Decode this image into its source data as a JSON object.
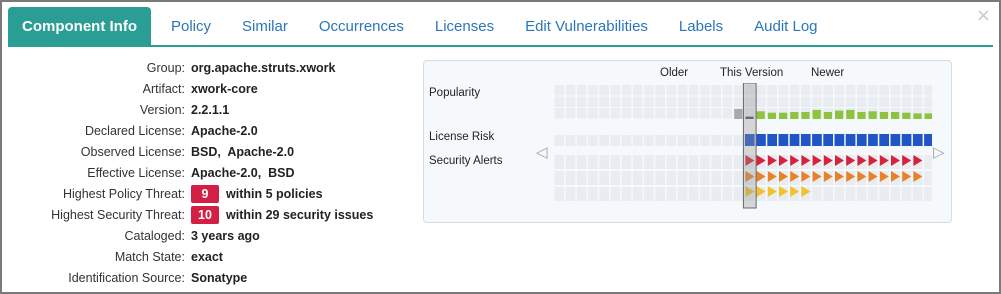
{
  "tabs": [
    {
      "label": "Component Info",
      "active": true
    },
    {
      "label": "Policy"
    },
    {
      "label": "Similar"
    },
    {
      "label": "Occurrences"
    },
    {
      "label": "Licenses"
    },
    {
      "label": "Edit Vulnerabilities"
    },
    {
      "label": "Labels"
    },
    {
      "label": "Audit Log"
    }
  ],
  "close_label": "×",
  "details": {
    "group": {
      "label": "Group:",
      "value": "org.apache.struts.xwork"
    },
    "artifact": {
      "label": "Artifact:",
      "value": "xwork-core"
    },
    "version": {
      "label": "Version:",
      "value": "2.2.1.1"
    },
    "declared_license": {
      "label": "Declared License:",
      "value": "Apache-2.0"
    },
    "observed_license": {
      "label": "Observed License:",
      "value": "BSD,  Apache-2.0"
    },
    "effective_license": {
      "label": "Effective License:",
      "value": "Apache-2.0,  BSD"
    },
    "highest_policy_threat": {
      "label": "Highest Policy Threat:",
      "badge": "9",
      "value": "within 5 policies"
    },
    "highest_security_threat": {
      "label": "Highest Security Threat:",
      "badge": "10",
      "value": "within 29 security issues"
    },
    "cataloged": {
      "label": "Cataloged:",
      "value": "3 years ago"
    },
    "match_state": {
      "label": "Match State:",
      "value": "exact"
    },
    "identification_source": {
      "label": "Identification Source:",
      "value": "Sonatype"
    }
  },
  "version_graph": {
    "headers": {
      "older": "Older",
      "this_version": "This Version",
      "newer": "Newer"
    },
    "rows": {
      "popularity": "Popularity",
      "license_risk": "License Risk",
      "security_alerts": "Security Alerts"
    },
    "colors": {
      "popularity_older": "#a9a9a9",
      "popularity_current": "#555555",
      "popularity_newer": "#8cc43f",
      "license_risk": "#1f55c4",
      "alert_critical": "#d6223a",
      "alert_severe": "#e8822a",
      "alert_moderate": "#f2c12e"
    },
    "popularity_level_current": 0.2,
    "popularity_levels_newer": [
      0.55,
      0.45,
      0.45,
      0.5,
      0.5,
      0.65,
      0.5,
      0.6,
      0.65,
      0.5,
      0.55,
      0.5,
      0.5,
      0.45,
      0.4,
      0.4,
      0.35,
      0.15
    ],
    "security_alerts": {
      "critical": {
        "count": 19,
        "starts_at_current": true
      },
      "severe": {
        "count": 18,
        "starts_at_current": true
      },
      "moderate": {
        "count": 6,
        "starts_at_current": true
      }
    }
  }
}
